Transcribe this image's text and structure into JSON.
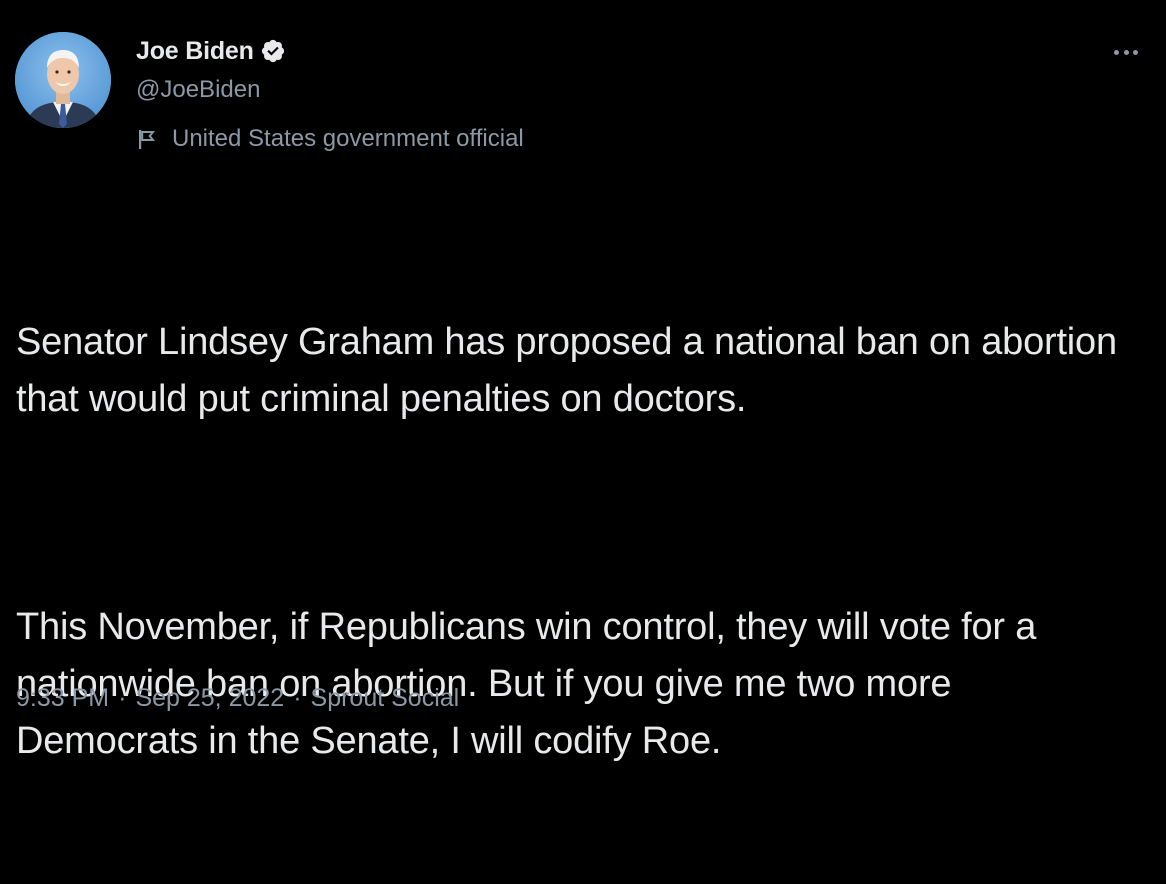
{
  "author": {
    "display_name": "Joe Biden",
    "handle": "@JoeBiden",
    "verified_icon": "verified-badge-icon",
    "label": "United States government official",
    "label_icon": "flag-icon"
  },
  "tweet": {
    "paragraphs": [
      "Senator Lindsey Graham has proposed a national ban on abortion that would put criminal penalties on doctors.",
      "This November, if Republicans win control, they will vote for a nationwide ban on abortion. But if you give me two more Democrats in the Senate, I will codify Roe."
    ]
  },
  "meta": {
    "time": "9:33 PM",
    "date": "Sep 25, 2022",
    "source": "Sprout Social",
    "separator": "·"
  },
  "menu": {
    "icon": "more-options-icon"
  },
  "colors": {
    "background": "#000000",
    "text_primary": "#e7e9ea",
    "text_secondary": "#8b98a5"
  }
}
